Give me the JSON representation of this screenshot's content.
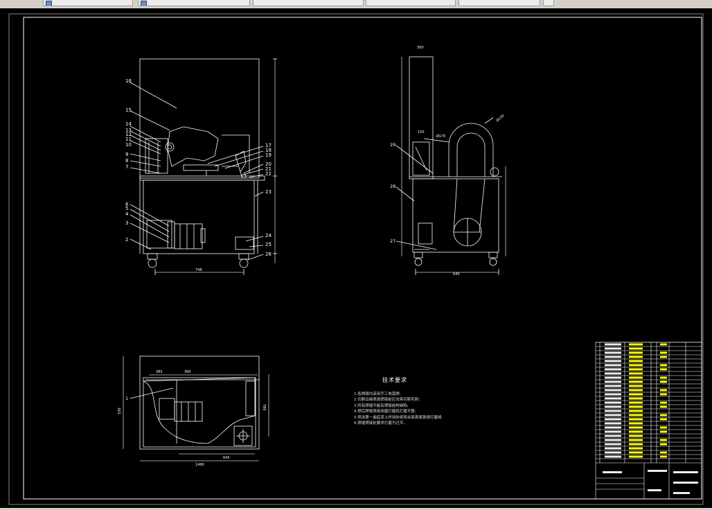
{
  "window": {
    "tabs": [
      "",
      "",
      "",
      "",
      "",
      ""
    ]
  },
  "drawing": {
    "front_view": {
      "labels": [
        "16",
        "15",
        "14",
        "13",
        "12",
        "11",
        "10",
        "9",
        "8",
        "7",
        "6",
        "5",
        "4",
        "3",
        "2",
        "17",
        "18",
        "19",
        "20",
        "21",
        "22",
        "23",
        "24",
        "25",
        "26"
      ],
      "width_dim": "748"
    },
    "side_view": {
      "labels": [
        "29",
        "28",
        "27"
      ],
      "dims": [
        "300",
        "150",
        "640",
        "Ø170",
        "Ø230"
      ]
    },
    "plan_view": {
      "labels": [
        "1"
      ],
      "dims": [
        "385",
        "390",
        "780",
        "530",
        "1460",
        "645"
      ]
    },
    "tech_requirements": {
      "title": "技术要求",
      "items": [
        "1.各焊缝均采用手工电弧焊;",
        "2.切割边缘表面焊接前应去除切割毛刺;",
        "3.所有焊缝不能有焊接结构缺陷;",
        "4.焊后焊缝表面用磨打磨机打磨平整;",
        "5.喷涂第一遍底漆上时用砂纸将台架表面铁锈打磨掉;",
        "6.焊缝焊接处要求打磨为过平。"
      ]
    }
  },
  "colors": {
    "background": "#000000",
    "line": "#ffffff",
    "highlight": "#ffff00",
    "chrome": "#d4d0c8"
  }
}
